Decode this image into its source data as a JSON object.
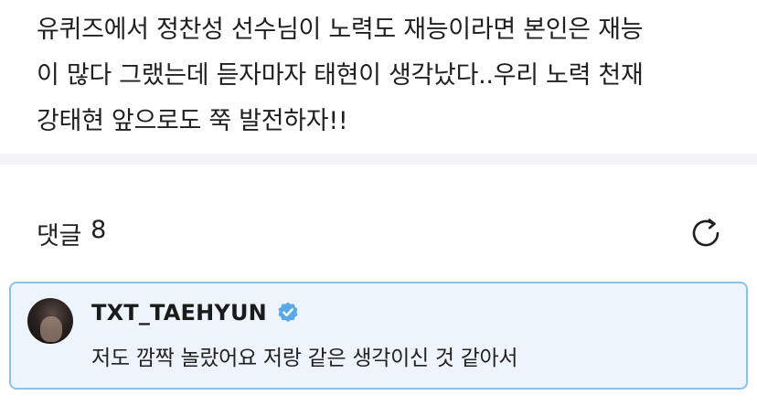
{
  "post": {
    "text": "유퀴즈에서 정찬성 선수님이 노력도 재능이라면 본인은 재능\n이 많다 그랬는데 듣자마자 태현이 생각났다..우리 노력 천재\n강태현 앞으로도 쭉 발전하자!!"
  },
  "comments": {
    "label": "댓글",
    "count": "8",
    "refresh_icon": "refresh-icon",
    "items": [
      {
        "username": "TXT_TAEHYUN",
        "verified": true,
        "text": "저도 깜짝 놀랐어요 저랑 같은 생각이신 것 같아서"
      }
    ]
  },
  "colors": {
    "highlight_bg": "#eef4fb",
    "highlight_border": "#8cc1ea",
    "verified_badge": "#5aa8e6",
    "divider": "#f3f4f8"
  }
}
